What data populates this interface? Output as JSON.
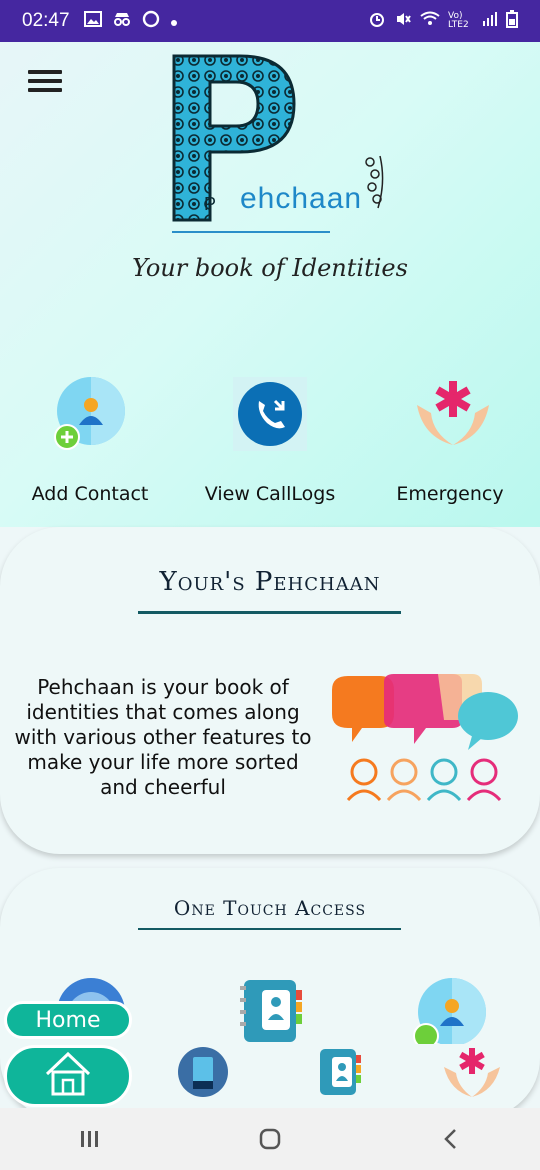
{
  "status_bar": {
    "time": "02:47",
    "left_icons": [
      "image-icon",
      "incognito-icon",
      "chat-bubble-icon",
      "dot-icon"
    ],
    "right_icons": [
      "alarm-icon",
      "mute-icon",
      "wifi-icon",
      "lte-signal-icon",
      "battery-icon"
    ],
    "network_label": "Vo) LTE2"
  },
  "header": {
    "logo_letter": "P",
    "logo_word": "ehchaan",
    "tagline": "Your book of Identities"
  },
  "actions": [
    {
      "label": "Add Contact",
      "icon": "add-contact-icon"
    },
    {
      "label": "View CallLogs",
      "icon": "call-logs-icon"
    },
    {
      "label": "Emergency",
      "icon": "emergency-icon"
    }
  ],
  "about": {
    "title": "Your's Pehchaan",
    "description": "Pehchaan is your book of identities that comes along with various other features to make your life more sorted and cheerful"
  },
  "one_touch": {
    "title": "One Touch Access",
    "items": [
      "profile-icon",
      "contacts-book-icon",
      "add-contact-icon"
    ]
  },
  "bottom": {
    "home_label": "Home",
    "icons": [
      "home-icon",
      "sd-card-icon",
      "contacts-book-icon",
      "emergency-icon"
    ]
  },
  "colors": {
    "status_bar": "#4527a0",
    "accent": "#0fb59a",
    "title_line": "#135a63",
    "logo_blue": "#1e88c8"
  }
}
